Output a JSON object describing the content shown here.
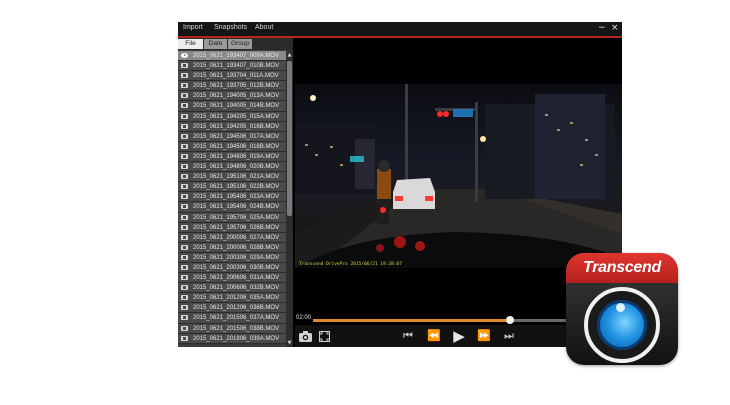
{
  "menu": {
    "import": "Import",
    "snapshots": "Snapshots",
    "about": "About"
  },
  "window": {
    "minimize_glyph": "−",
    "close_glyph": "×"
  },
  "tabs": {
    "file": "File",
    "date": "Date",
    "group": "Group"
  },
  "files": [
    "2015_0621_193407_009A.MOV",
    "2015_0621_193407_010B.MOV",
    "2015_0621_193704_011A.MOV",
    "2015_0621_193705_012B.MOV",
    "2015_0621_194005_013A.MOV",
    "2015_0621_194005_014B.MOV",
    "2015_0621_194205_015A.MOV",
    "2015_0621_194205_016B.MOV",
    "2015_0621_194506_017A.MOV",
    "2015_0621_194506_018B.MOV",
    "2015_0621_194806_019A.MOV",
    "2015_0621_194806_020B.MOV",
    "2015_0621_195106_021A.MOV",
    "2015_0621_195106_022B.MOV",
    "2015_0621_195406_023A.MOV",
    "2015_0621_195406_024B.MOV",
    "2015_0621_195706_025A.MOV",
    "2015_0621_195706_026B.MOV",
    "2015_0621_200006_027A.MOV",
    "2015_0621_200006_028B.MOV",
    "2015_0621_200306_029A.MOV",
    "2015_0621_200306_030B.MOV",
    "2015_0621_200606_031A.MOV",
    "2015_0621_200606_032B.MOV",
    "2015_0621_201206_035A.MOV",
    "2015_0621_201206_036B.MOV",
    "2015_0621_201506_037A.MOV",
    "2015_0621_201506_038B.MOV",
    "2015_0621_201806_039A.MOV"
  ],
  "selected_file_index": 0,
  "video": {
    "osd": "Transcend DrivePro 2015/06/21 19:38:07"
  },
  "playback": {
    "timecode": "02:00",
    "progress": 0.68
  },
  "logo": {
    "brand": "Transcend"
  },
  "icons": {
    "selected_file": "play-circle-icon",
    "file": "film-icon",
    "snapshot": "camera-icon",
    "fullscreen": "fullscreen-icon",
    "previous": "skip-previous-icon",
    "rewind": "rewind-icon",
    "play": "play-icon",
    "forward": "fast-forward-icon",
    "next": "skip-next-icon"
  },
  "colors": {
    "accent": "#b5271c",
    "progress": "#e08a2a",
    "lens": "#1c8fe0"
  }
}
